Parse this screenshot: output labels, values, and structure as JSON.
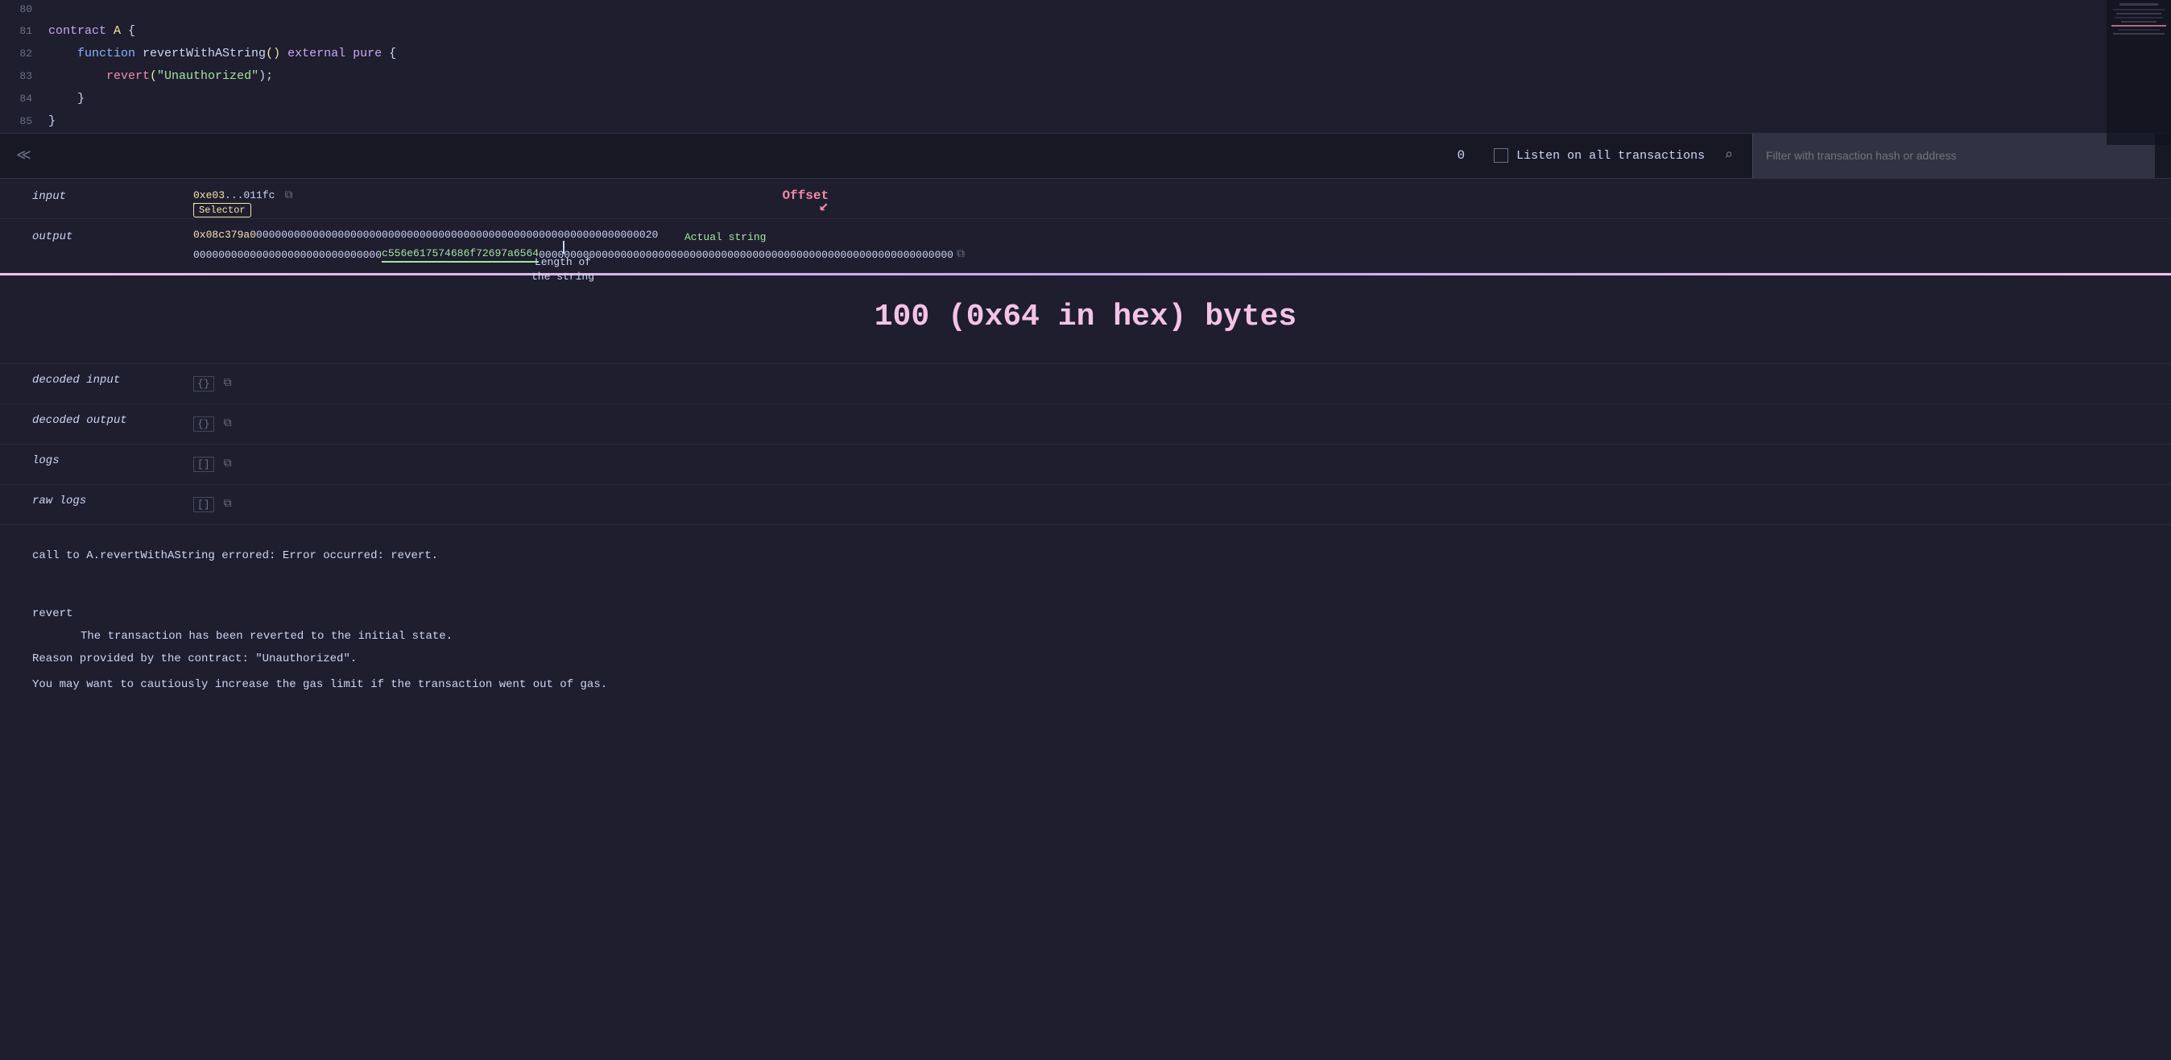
{
  "codeEditor": {
    "lines": [
      {
        "number": "80",
        "tokens": []
      },
      {
        "number": "81",
        "content": "contract A {",
        "parts": [
          {
            "text": "contract ",
            "class": "kw-contract"
          },
          {
            "text": "A ",
            "class": "class-name"
          },
          {
            "text": "{",
            "class": "brace"
          }
        ]
      },
      {
        "number": "82",
        "content": "    function revertWithAString() external pure {",
        "parts": [
          {
            "text": "    function ",
            "class": "kw-function"
          },
          {
            "text": "revertWithAString",
            "class": ""
          },
          {
            "text": "() ",
            "class": ""
          },
          {
            "text": "external ",
            "class": "kw-external"
          },
          {
            "text": "pure ",
            "class": "kw-pure"
          },
          {
            "text": "{",
            "class": "brace"
          }
        ]
      },
      {
        "number": "83",
        "content": "        revert(\"Unauthorized\");",
        "parts": [
          {
            "text": "        revert",
            "class": "kw-revert"
          },
          {
            "text": "(",
            "class": "paren"
          },
          {
            "text": "\"Unauthorized\"",
            "class": "string-val"
          },
          {
            "text": ");",
            "class": ""
          }
        ]
      },
      {
        "number": "84",
        "content": "    }",
        "parts": [
          {
            "text": "    }",
            "class": "brace"
          }
        ]
      },
      {
        "number": "85",
        "content": "}",
        "parts": [
          {
            "text": "}",
            "class": "brace"
          }
        ]
      }
    ]
  },
  "toolbar": {
    "chevron_label": "≪",
    "transaction_count": "0",
    "listen_label": "Listen on all transactions",
    "search_icon": "🔍",
    "filter_placeholder": "Filter with transaction hash or address"
  },
  "transaction": {
    "input_label": "input",
    "input_value": "0xe03...011fc",
    "output_label": "output",
    "output_hex1": "0x08c379a00000000000000000000000000000000000000000000000000000000000000020",
    "output_hex2": "000000000000000000000000000000c556e617574686f72697a656400000000000000000000000000000000000000000000000000000000000000000000000000",
    "decoded_input_label": "decoded input",
    "decoded_output_label": "decoded output",
    "logs_label": "logs",
    "raw_logs_label": "raw logs",
    "selector_annotation": "Selector",
    "offset_annotation": "Offset",
    "length_annotation": "Length of\nthe string",
    "actual_string_annotation": "Actual string",
    "big_annotation": "100 (0x64 in hex) bytes"
  },
  "errorSection": {
    "line1": "call to A.revertWithAString errored: Error occurred: revert.",
    "line2": "",
    "revert_title": "revert",
    "revert_body": "        The transaction has been reverted to the initial state.",
    "reason_line": "Reason provided by the contract: \"Unauthorized\".",
    "gas_line": "You may want to cautiously increase the gas limit if the transaction went out of gas."
  },
  "icons": {
    "copy": "⧉",
    "json_open": "{}",
    "array_open": "[]",
    "search": "⌕"
  }
}
